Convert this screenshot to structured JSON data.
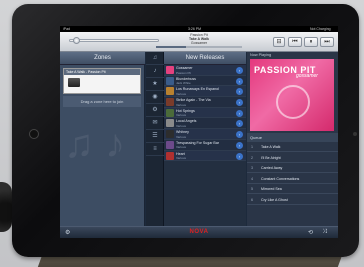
{
  "statusbar": {
    "left": "iPad",
    "time": "3:26 PM",
    "right": "Not Charging"
  },
  "now_playing_header": {
    "line1": "Passion Pit",
    "line2": "Take A Walk",
    "line3": "Gossamer"
  },
  "toolbar": {
    "volume_fraction": 0.05,
    "progress_fraction": 0.35,
    "queue_btn": "⊟",
    "prev_btn": "⏮",
    "pause_btn": "⏸",
    "next_btn": "⏭"
  },
  "zones": {
    "title": "Zones",
    "zone_strip": "Take A Walk - Passion Pit",
    "drop_hint": "Drag a zone here to join"
  },
  "mid_tabs": [
    "♫",
    "♪",
    "★",
    "◉",
    "⚙",
    "✉",
    "☰",
    "≡"
  ],
  "releases": {
    "title": "New Releases",
    "items": [
      {
        "title": "Gossamer",
        "artist": "Passion Pit",
        "color": "#e5417e"
      },
      {
        "title": "Blunderbuss",
        "artist": "Jack White",
        "color": "#3a5c8a"
      },
      {
        "title": "Los Runaways En Espanol",
        "artist": "Various",
        "color": "#b9812f"
      },
      {
        "title": "Strike Again - The Via",
        "artist": "Various",
        "color": "#7a3b2a"
      },
      {
        "title": "Hot Springs",
        "artist": "Various",
        "color": "#4b6b3a"
      },
      {
        "title": "Local Angels",
        "artist": "Various",
        "color": "#8a8a8a"
      },
      {
        "title": "Whitney",
        "artist": "Various",
        "color": "#2d2d2d"
      },
      {
        "title": "Trespassing For Sugar Bar",
        "artist": "Various",
        "color": "#6d4a8a"
      },
      {
        "title": "Heart",
        "artist": "Various",
        "color": "#b03030"
      }
    ]
  },
  "now_playing": {
    "label": "Now Playing",
    "album_band": "PASSION PIT",
    "album_script": "gossamer",
    "queue_label": "Queue",
    "queue": [
      {
        "n": "1",
        "title": "Take A Walk"
      },
      {
        "n": "2",
        "title": "I'll Be Alright"
      },
      {
        "n": "3",
        "title": "Carried Away"
      },
      {
        "n": "4",
        "title": "Constant Conversations"
      },
      {
        "n": "5",
        "title": "Mirrored Sea"
      },
      {
        "n": "6",
        "title": "Cry Like A Ghost"
      }
    ]
  },
  "bottombar": {
    "brand": "NOVA"
  },
  "colors": {
    "accent": "#3a72c8",
    "brand": "#e02020",
    "album": "#e4387d"
  }
}
